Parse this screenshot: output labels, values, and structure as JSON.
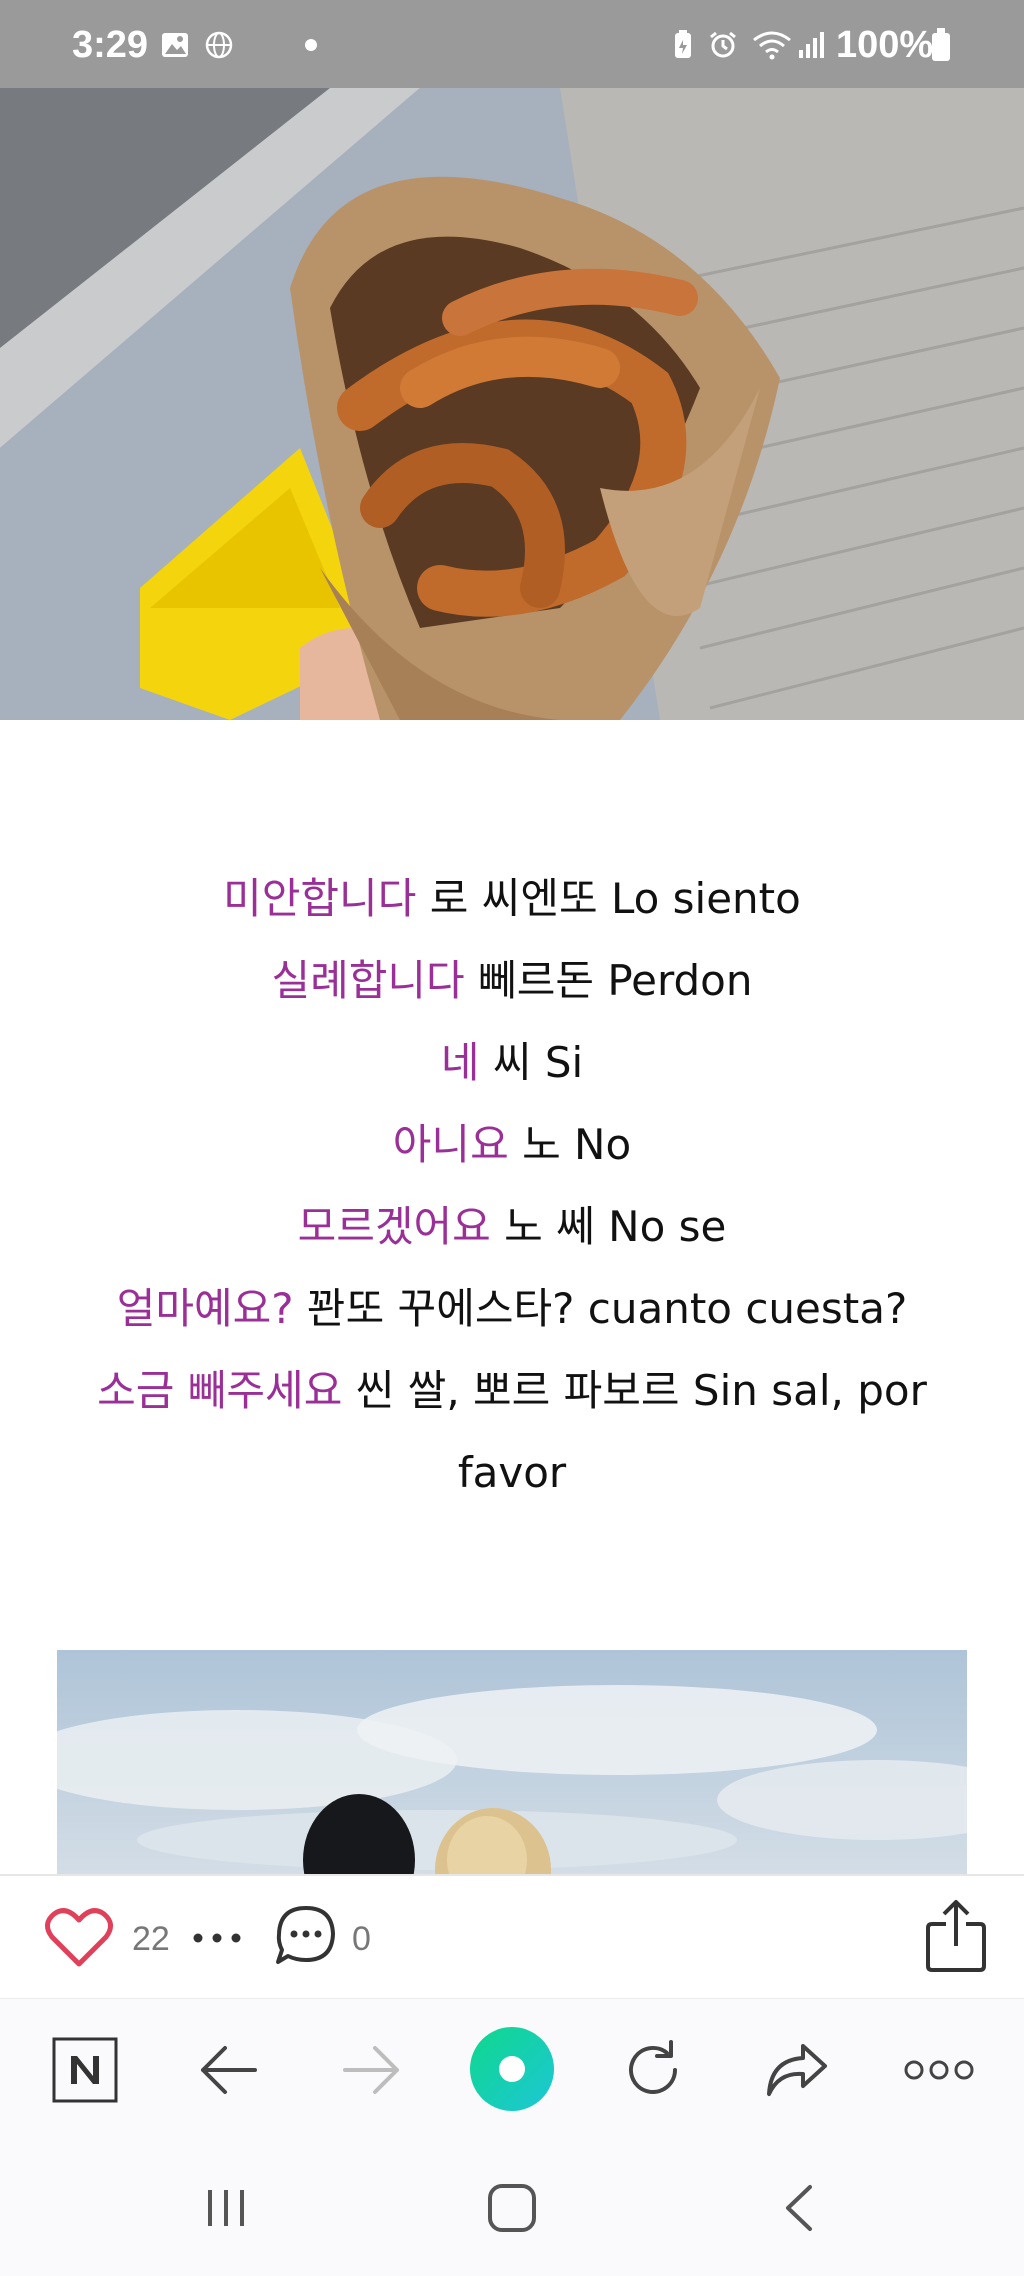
{
  "status_bar": {
    "time": "3:29",
    "battery": "100%",
    "icons": [
      "gallery-icon",
      "globe-icon",
      "dot-icon",
      "battery-saver-icon",
      "alarm-icon",
      "wifi-icon",
      "signal-icon",
      "battery-icon"
    ]
  },
  "article": {
    "top_image": "churros-in-paper-cone-photo",
    "bottom_image": "sky-and-two-people-photo",
    "phrases": [
      {
        "ko": "미안합니다",
        "rest": " 로 씨엔또 Lo siento"
      },
      {
        "ko": "실례합니다",
        "rest": " 뻬르돈 Perdon"
      },
      {
        "ko": "네",
        "rest": " 씨 Si"
      },
      {
        "ko": "아니요",
        "rest": " 노 No"
      },
      {
        "ko": "모르겠어요",
        "rest": " 노 쎄 No se"
      },
      {
        "ko": "얼마예요?",
        "rest": " 꽌또 꾸에스타? cuanto cuesta?"
      },
      {
        "ko": "소금 빼주세요",
        "rest": " 씬 쌀, 뽀르 파보르 Sin sal, por"
      }
    ],
    "phrase_continuation": "favor",
    "accent_color": "#9b2f98"
  },
  "reactions": {
    "like_count": "22",
    "comment_count": "0",
    "like_color": "#e0405a"
  },
  "browser_toolbar": {
    "buttons": [
      "naver-home-button",
      "back-button",
      "forward-button",
      "green-dot-button",
      "refresh-button",
      "share-button",
      "more-button"
    ],
    "accent_color": "#19d3a6"
  },
  "system_nav": {
    "buttons": [
      "recent-apps-button",
      "home-button",
      "back-button"
    ]
  }
}
